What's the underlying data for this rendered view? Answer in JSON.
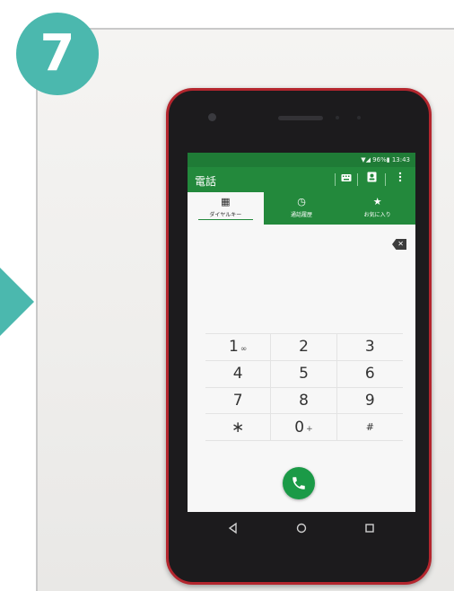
{
  "step": {
    "number": "7"
  },
  "colors": {
    "accent": "#4bb8ae",
    "app_green": "#23893c",
    "call_green": "#1b9a47",
    "phone_red": "#b4262e"
  },
  "status_bar": {
    "text": "▼◢ 96%▮ 13:43"
  },
  "app_bar": {
    "title": "電話",
    "icons": [
      "keyboard-icon",
      "contacts-icon",
      "overflow-menu-icon"
    ]
  },
  "tabs": [
    {
      "label": "ダイヤルキー",
      "icon": "dialpad-icon",
      "glyph": "▦",
      "active": true
    },
    {
      "label": "通話履歴",
      "icon": "history-clock-icon",
      "glyph": "◷",
      "active": false
    },
    {
      "label": "お気に入り",
      "icon": "star-icon",
      "glyph": "★",
      "active": false
    }
  ],
  "keypad": {
    "keys": [
      {
        "digit": "1",
        "sub": "∞"
      },
      {
        "digit": "2",
        "sub": ""
      },
      {
        "digit": "3",
        "sub": ""
      },
      {
        "digit": "4",
        "sub": ""
      },
      {
        "digit": "5",
        "sub": ""
      },
      {
        "digit": "6",
        "sub": ""
      },
      {
        "digit": "7",
        "sub": ""
      },
      {
        "digit": "8",
        "sub": ""
      },
      {
        "digit": "9",
        "sub": ""
      },
      {
        "digit": "∗",
        "sub": ""
      },
      {
        "digit": "0",
        "sub": "+"
      },
      {
        "digit": "#",
        "sub": ""
      }
    ]
  },
  "navigation": [
    "back-icon",
    "home-icon",
    "recents-icon"
  ]
}
